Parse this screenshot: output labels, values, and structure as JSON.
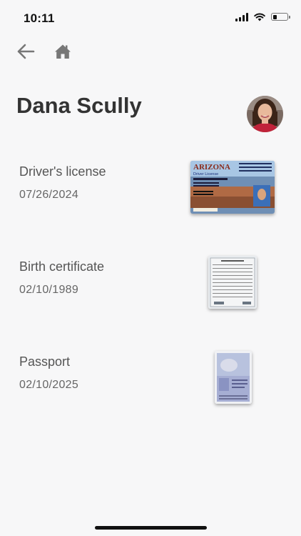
{
  "status_bar": {
    "time": "10:11",
    "battery_level": 0.3
  },
  "nav": {
    "back_icon": "arrow-left-icon",
    "home_icon": "home-icon"
  },
  "profile": {
    "name": "Dana Scully"
  },
  "documents": [
    {
      "name": "Driver's license",
      "date": "07/26/2024",
      "thumb": {
        "title": "ARIZONA",
        "subtitle": "Driver License"
      }
    },
    {
      "name": "Birth certificate",
      "date": "02/10/1989"
    },
    {
      "name": "Passport",
      "date": "02/10/2025"
    }
  ],
  "colors": {
    "background": "#f7f7f8",
    "text": "#333333",
    "secondary_text": "#666666",
    "icon": "#777777"
  }
}
